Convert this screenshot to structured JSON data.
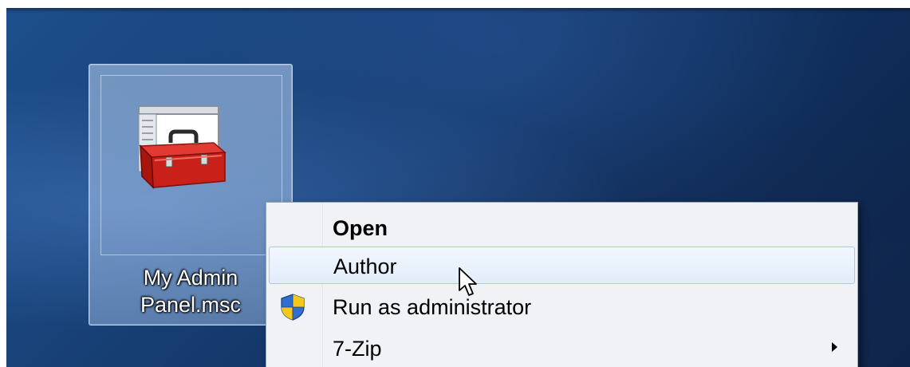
{
  "desktop": {
    "icon": {
      "name": "toolbox-msc-icon",
      "label": "My Admin\nPanel.msc"
    }
  },
  "context_menu": {
    "items": [
      {
        "label": "Open",
        "bold": true
      },
      {
        "label": "Author",
        "hovered": true
      },
      {
        "label": "Run as administrator",
        "icon": "uac-shield-icon"
      },
      {
        "label": "7-Zip",
        "submenu": true
      }
    ]
  },
  "colors": {
    "menu_background": "#f1f2f5",
    "hover_border": "#a9c8ee",
    "desktop_blue": "#173f74"
  }
}
